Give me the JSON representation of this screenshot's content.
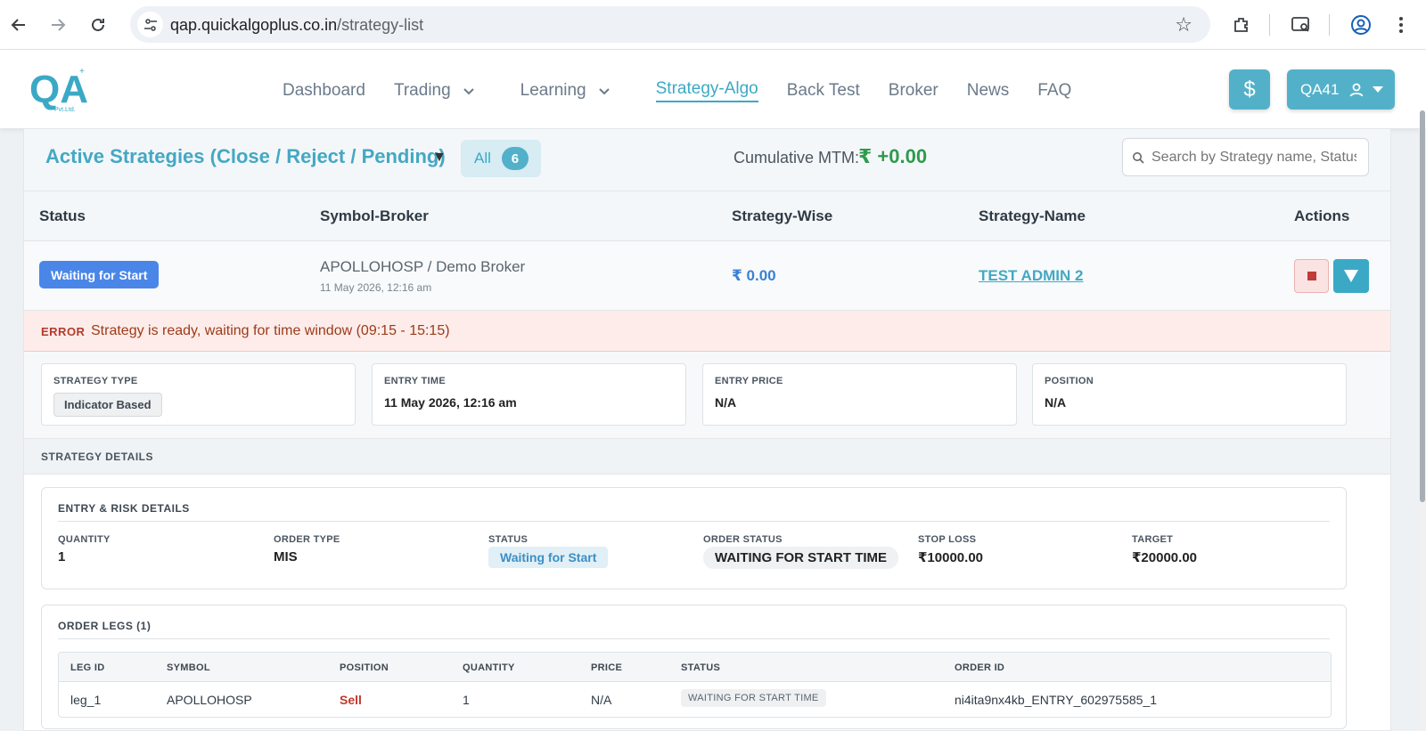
{
  "browser": {
    "url_host": "qap.quickalgoplus.co.in",
    "url_path": "/strategy-list"
  },
  "header": {
    "logo_text": "QA",
    "logo_sub": "Pvt.Ltd.",
    "nav": [
      {
        "label": "Dashboard",
        "dropdown": false
      },
      {
        "label": "Trading",
        "dropdown": true
      },
      {
        "label": "Learning",
        "dropdown": true
      },
      {
        "label": "Strategy-Algo",
        "dropdown": false,
        "active": true
      },
      {
        "label": "Back Test",
        "dropdown": false
      },
      {
        "label": "Broker",
        "dropdown": false
      },
      {
        "label": "News",
        "dropdown": false
      },
      {
        "label": "FAQ",
        "dropdown": false
      }
    ],
    "dollar_icon": "$",
    "user_label": "QA41"
  },
  "panel": {
    "title": "Active Strategies (Close / Reject / Pending)",
    "filter_label": "All",
    "filter_count": "6",
    "mtm_label": "Cumulative MTM:",
    "mtm_value": "₹ +0.00",
    "search_placeholder": "Search by Strategy name, Status"
  },
  "table": {
    "columns": [
      "Status",
      "Symbol-Broker",
      "Strategy-Wise",
      "Strategy-Name",
      "Actions"
    ],
    "row": {
      "status": "Waiting for Start",
      "symbol_broker": "APOLLOHOSP / Demo Broker",
      "date": "11 May 2026, 12:16 am",
      "strategy_wise": "₹ 0.00",
      "strategy_name": "TEST ADMIN 2"
    }
  },
  "error": {
    "tag": "ERROR",
    "message": "Strategy is ready, waiting for time window (09:15 - 15:15)"
  },
  "info_boxes": {
    "strategy_type_label": "STRATEGY TYPE",
    "strategy_type_value": "Indicator Based",
    "entry_time_label": "ENTRY TIME",
    "entry_time_value": "11 May 2026, 12:16 am",
    "entry_price_label": "ENTRY PRICE",
    "entry_price_value": "N/A",
    "position_label": "POSITION",
    "position_value": "N/A"
  },
  "details": {
    "section_title": "STRATEGY DETAILS",
    "erd_title": "ENTRY & RISK DETAILS",
    "quantity_label": "QUANTITY",
    "quantity_value": "1",
    "order_type_label": "ORDER TYPE",
    "order_type_value": "MIS",
    "status_label": "STATUS",
    "status_value": "Waiting for Start",
    "order_status_label": "ORDER STATUS",
    "order_status_value": "WAITING FOR START TIME",
    "stop_loss_label": "STOP LOSS",
    "stop_loss_value": "₹10000.00",
    "target_label": "TARGET",
    "target_value": "₹20000.00"
  },
  "legs": {
    "title": "ORDER LEGS (1)",
    "columns": [
      "LEG ID",
      "SYMBOL",
      "POSITION",
      "QUANTITY",
      "PRICE",
      "STATUS",
      "ORDER ID"
    ],
    "row": {
      "leg_id": "leg_1",
      "symbol": "APOLLOHOSP",
      "position": "Sell",
      "quantity": "1",
      "price": "N/A",
      "status": "WAITING FOR START TIME",
      "order_id": "ni4ita9nx4kb_ENTRY_602975585_1"
    }
  },
  "colors": {
    "accent": "#3ba9c6",
    "status_blue": "#4a86e8",
    "mtm_green": "#2e9b4d",
    "sell_red": "#c0392b",
    "error_bg": "#fdecea"
  }
}
